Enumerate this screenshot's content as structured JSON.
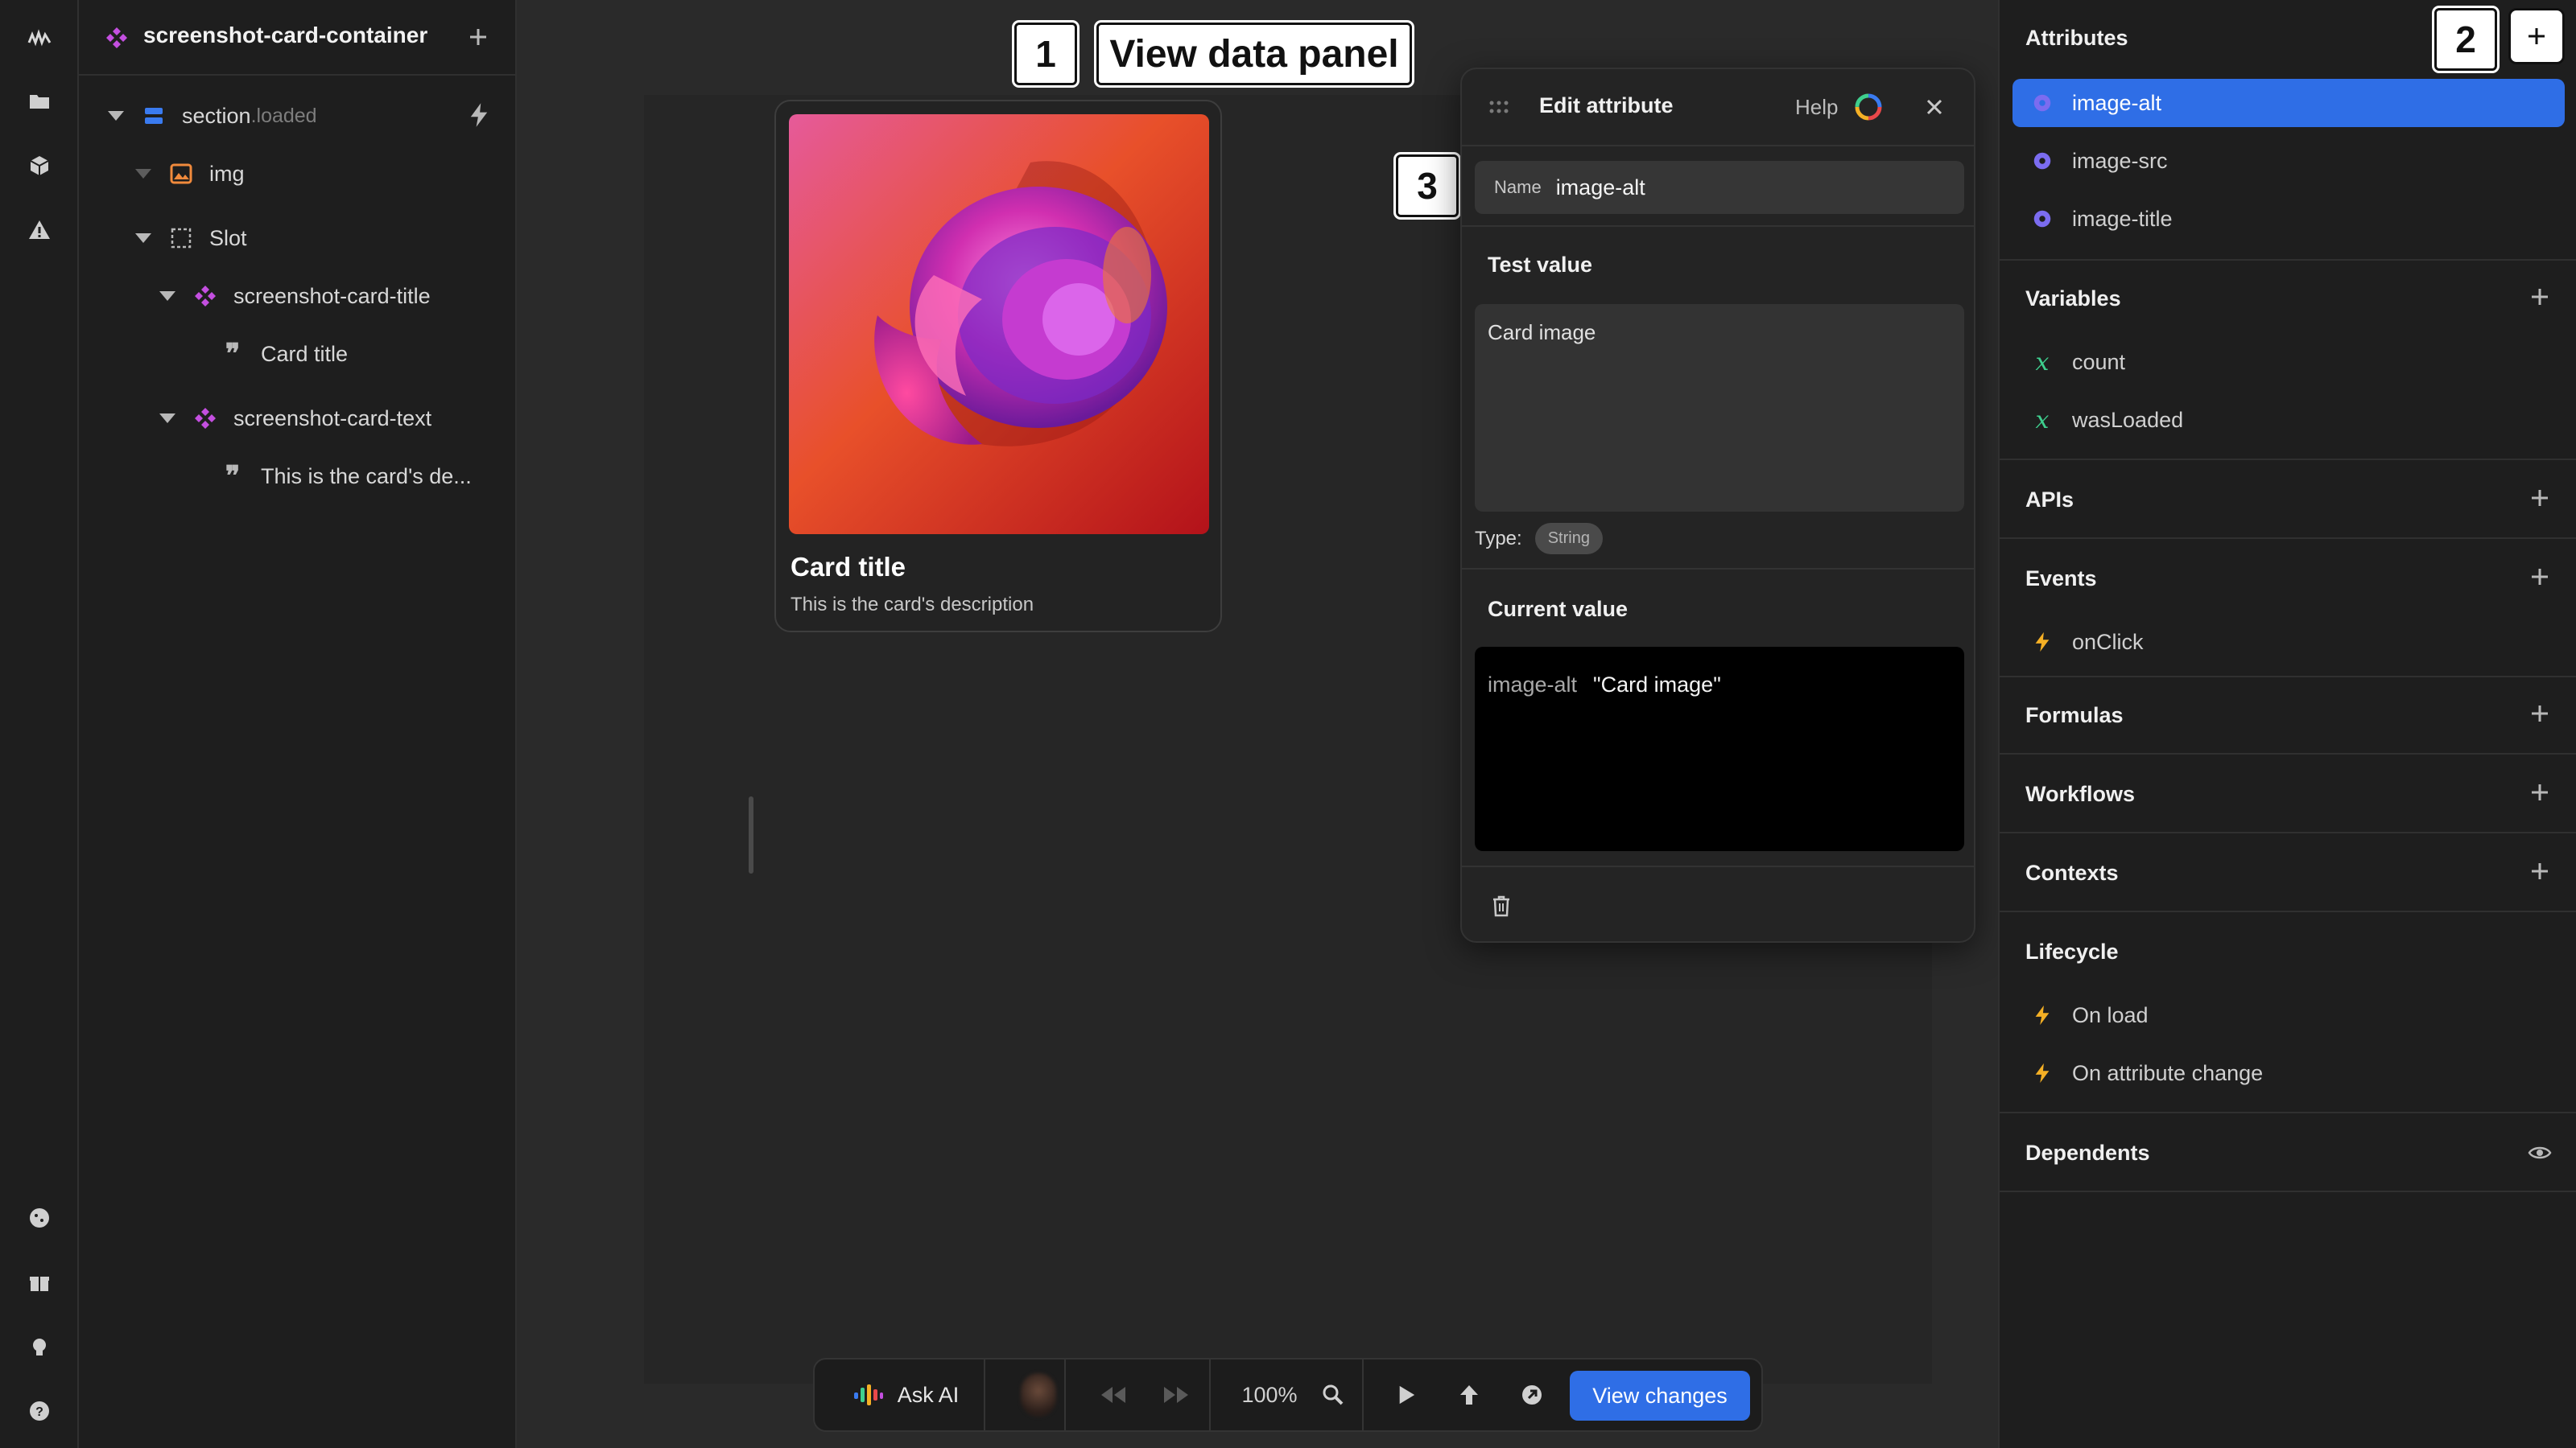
{
  "layers": {
    "title": "screenshot-card-container",
    "tree": [
      {
        "label": "section",
        "suffix": ".loaded"
      },
      {
        "label": "img"
      },
      {
        "label": "Slot"
      },
      {
        "label": "screenshot-card-title"
      },
      {
        "label": "Card title"
      },
      {
        "label": "screenshot-card-text"
      },
      {
        "label": "This is the card's de..."
      }
    ]
  },
  "callouts": {
    "one": "1",
    "view_data_panel": "View data panel",
    "two": "2",
    "three": "3"
  },
  "card": {
    "title": "Card title",
    "description": "This is the card's description"
  },
  "edit_attribute": {
    "title": "Edit attribute",
    "help": "Help",
    "name_label": "Name",
    "name_value": "image-alt",
    "test_value_label": "Test value",
    "test_value": "Card image",
    "type_label": "Type:",
    "type_value": "String",
    "current_value_label": "Current value",
    "current_key": "image-alt",
    "current_value": "\"Card image\""
  },
  "right_panel": {
    "attributes": {
      "title": "Attributes",
      "items": [
        "image-alt",
        "image-src",
        "image-title"
      ]
    },
    "variables": {
      "title": "Variables",
      "items": [
        "count",
        "wasLoaded"
      ]
    },
    "apis": {
      "title": "APIs"
    },
    "events": {
      "title": "Events",
      "items": [
        "onClick"
      ]
    },
    "formulas": {
      "title": "Formulas"
    },
    "workflows": {
      "title": "Workflows"
    },
    "contexts": {
      "title": "Contexts"
    },
    "lifecycle": {
      "title": "Lifecycle",
      "items": [
        "On load",
        "On attribute change"
      ]
    },
    "dependents": {
      "title": "Dependents"
    }
  },
  "toolbar": {
    "ask_ai": "Ask AI",
    "zoom": "100%",
    "view_changes": "View changes"
  },
  "colors": {
    "accent": "#2f6ee6",
    "component": "#c44fe0",
    "formula_icon": "#7b6cf0",
    "variable_icon": "#3ecf8e",
    "event_icon": "#f5b025",
    "img_icon": "#f08a3c",
    "section_icon": "#3a7bf0"
  }
}
